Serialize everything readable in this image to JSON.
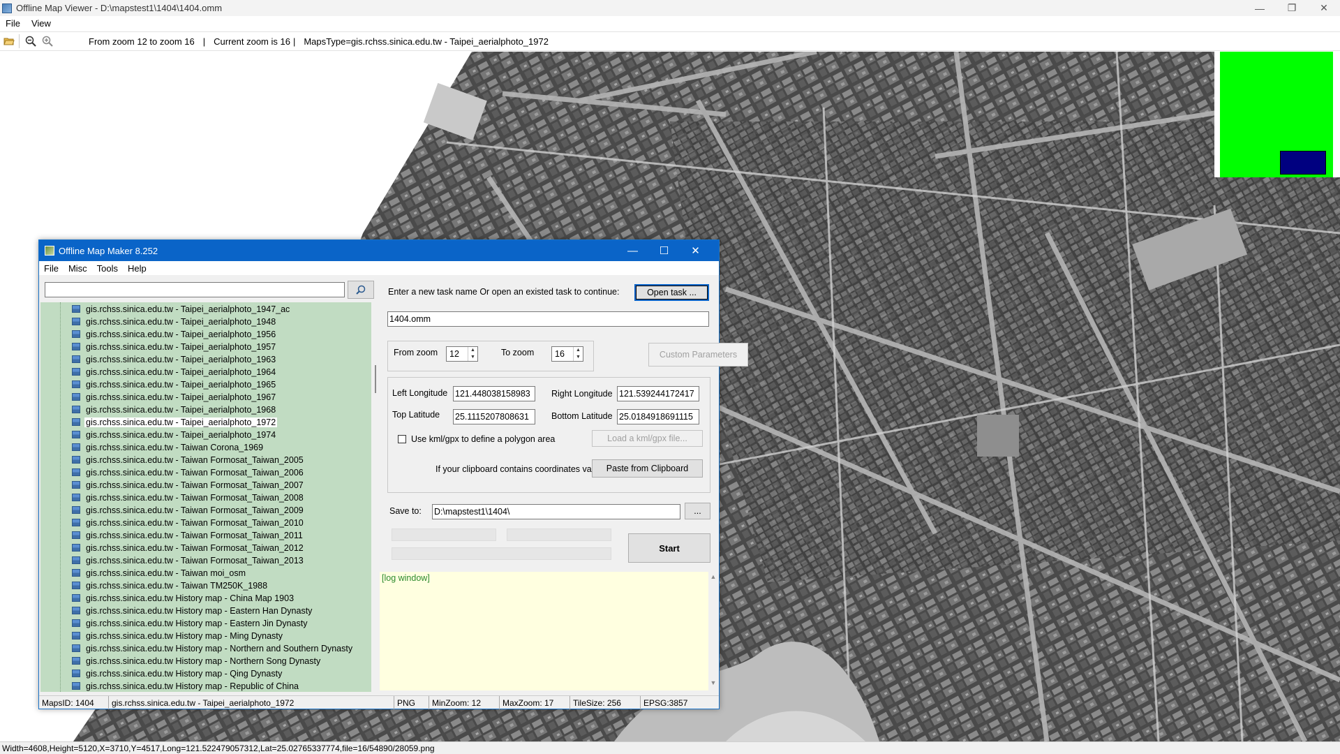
{
  "viewer": {
    "title": "Offline Map Viewer - D:\\mapstest1\\1404\\1404.omm",
    "menu": [
      "File",
      "View"
    ],
    "toolbar": {
      "zoom_range": "From zoom 12 to zoom 16",
      "sep1": "|",
      "current_zoom": "Current zoom is 16",
      "sep2": "|",
      "maps_type": "MapsType=gis.rchss.sinica.edu.tw - Taipei_aerialphoto_1972"
    },
    "status": "Width=4608,Height=5120,X=3710,Y=4517,Long=121.522479057312,Lat=25.02765337774,file=16/54890/28059.png"
  },
  "maker": {
    "title": "Offline Map Maker 8.252",
    "menu": [
      "File",
      "Misc",
      "Tools",
      "Help"
    ],
    "search_value": "",
    "tree_items": [
      "gis.rchss.sinica.edu.tw - Taipei_aerialphoto_1947_ac",
      "gis.rchss.sinica.edu.tw - Taipei_aerialphoto_1948",
      "gis.rchss.sinica.edu.tw - Taipei_aerialphoto_1956",
      "gis.rchss.sinica.edu.tw - Taipei_aerialphoto_1957",
      "gis.rchss.sinica.edu.tw - Taipei_aerialphoto_1963",
      "gis.rchss.sinica.edu.tw - Taipei_aerialphoto_1964",
      "gis.rchss.sinica.edu.tw - Taipei_aerialphoto_1965",
      "gis.rchss.sinica.edu.tw - Taipei_aerialphoto_1967",
      "gis.rchss.sinica.edu.tw - Taipei_aerialphoto_1968",
      "gis.rchss.sinica.edu.tw - Taipei_aerialphoto_1972",
      "gis.rchss.sinica.edu.tw - Taipei_aerialphoto_1974",
      "gis.rchss.sinica.edu.tw - Taiwan Corona_1969",
      "gis.rchss.sinica.edu.tw - Taiwan Formosat_Taiwan_2005",
      "gis.rchss.sinica.edu.tw - Taiwan Formosat_Taiwan_2006",
      "gis.rchss.sinica.edu.tw - Taiwan Formosat_Taiwan_2007",
      "gis.rchss.sinica.edu.tw - Taiwan Formosat_Taiwan_2008",
      "gis.rchss.sinica.edu.tw - Taiwan Formosat_Taiwan_2009",
      "gis.rchss.sinica.edu.tw - Taiwan Formosat_Taiwan_2010",
      "gis.rchss.sinica.edu.tw - Taiwan Formosat_Taiwan_2011",
      "gis.rchss.sinica.edu.tw - Taiwan Formosat_Taiwan_2012",
      "gis.rchss.sinica.edu.tw - Taiwan Formosat_Taiwan_2013",
      "gis.rchss.sinica.edu.tw - Taiwan moi_osm",
      "gis.rchss.sinica.edu.tw - Taiwan TM250K_1988",
      "gis.rchss.sinica.edu.tw History map - China Map 1903",
      "gis.rchss.sinica.edu.tw History map - Eastern Han Dynasty",
      "gis.rchss.sinica.edu.tw History map - Eastern Jin Dynasty",
      "gis.rchss.sinica.edu.tw History map - Ming Dynasty",
      "gis.rchss.sinica.edu.tw History map - Northern and Southern Dynasty",
      "gis.rchss.sinica.edu.tw History map - Northern Song Dynasty",
      "gis.rchss.sinica.edu.tw History map - Qing Dynasty",
      "gis.rchss.sinica.edu.tw History map - Republic of China"
    ],
    "selected_index": 9,
    "task_prompt": "Enter a new task name Or open an existed task to continue:",
    "open_task_label": "Open task ...",
    "task_name": "1404.omm",
    "from_zoom_label": "From zoom",
    "from_zoom_value": "12",
    "to_zoom_label": "To zoom",
    "to_zoom_value": "16",
    "custom_params_label": "Custom Parameters",
    "left_lon_label": "Left Longitude",
    "left_lon_value": "121.448038158983",
    "right_lon_label": "Right Longitude",
    "right_lon_value": "121.539244172417",
    "top_lat_label": "Top Latitude",
    "top_lat_value": "25.1115207808631",
    "bottom_lat_label": "Bottom Latitude",
    "bottom_lat_value": "25.0184918691115",
    "kml_checkbox_label": "Use kml/gpx to define a polygon area",
    "load_kml_label": "Load a kml/gpx file...",
    "clipboard_label": "If your clipboard contains coordinates values:",
    "paste_label": "Paste from Clipboard",
    "save_to_label": "Save to:",
    "save_to_value": "D:\\mapstest1\\1404\\",
    "browse_label": "...",
    "start_label": "Start",
    "log_text": "[log window]",
    "status": {
      "maps_id": "MapsID: 1404",
      "maps_name": "gis.rchss.sinica.edu.tw - Taipei_aerialphoto_1972",
      "format": "PNG",
      "min_zoom": "MinZoom: 12",
      "max_zoom": "MaxZoom: 17",
      "tile_size": "TileSize: 256",
      "epsg": "EPSG:3857"
    }
  },
  "colors": {
    "titlebar_active": "#0a64c8",
    "tree_bg": "#c1dcc2",
    "log_bg": "#ffffe0",
    "minimap_green": "#00ff00",
    "minimap_viewport": "#000080"
  },
  "icons": [
    "folder-open-icon",
    "zoom-out-icon",
    "zoom-in-icon",
    "search-icon",
    "minimize-icon",
    "maximize-icon",
    "close-icon",
    "map-layer-icon"
  ]
}
